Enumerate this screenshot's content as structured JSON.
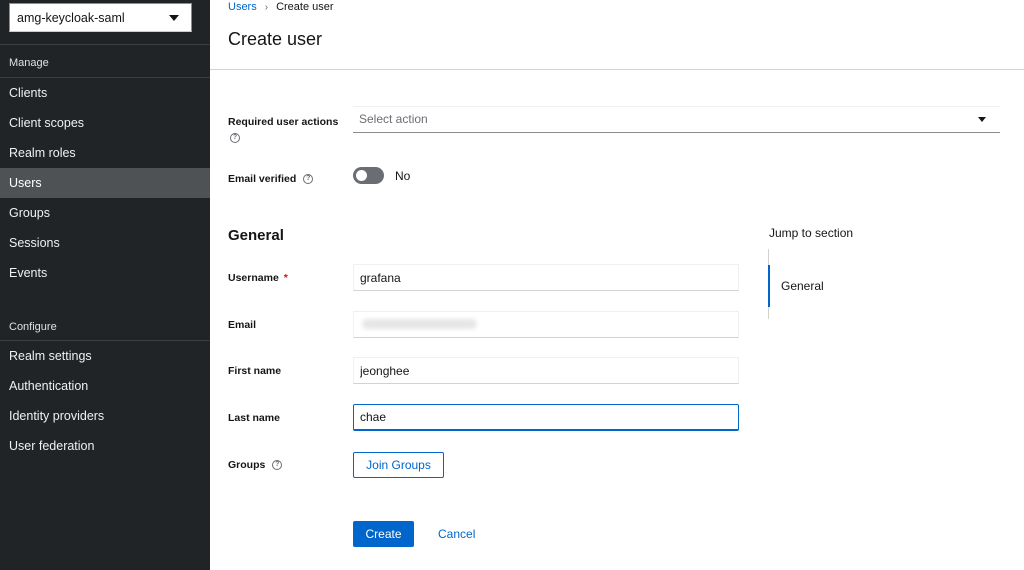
{
  "sidebar": {
    "realm": "amg-keycloak-saml",
    "manage_title": "Manage",
    "manage_items": [
      "Clients",
      "Client scopes",
      "Realm roles",
      "Users",
      "Groups",
      "Sessions",
      "Events"
    ],
    "active_item": "Users",
    "configure_title": "Configure",
    "configure_items": [
      "Realm settings",
      "Authentication",
      "Identity providers",
      "User federation"
    ]
  },
  "breadcrumb": {
    "parent": "Users",
    "current": "Create user"
  },
  "page": {
    "title": "Create user"
  },
  "form": {
    "required_actions_label": "Required user actions",
    "required_actions_placeholder": "Select action",
    "email_verified_label": "Email verified",
    "email_verified_value": "No",
    "general_heading": "General",
    "username_label": "Username",
    "username_value": "grafana",
    "email_label": "Email",
    "email_value": "",
    "first_name_label": "First name",
    "first_name_value": "jeonghee",
    "last_name_label": "Last name",
    "last_name_value": "chae",
    "groups_label": "Groups",
    "join_groups_button": "Join Groups",
    "create_button": "Create",
    "cancel_button": "Cancel"
  },
  "jump": {
    "title": "Jump to section",
    "items": [
      "General"
    ]
  },
  "icons": {
    "help": "help-circle-icon",
    "caret": "caret-down-icon",
    "required": "*"
  },
  "colors": {
    "sidebar_bg": "#212427",
    "active_nav_bg": "#4f5255",
    "accent": "#0066cc",
    "required": "#c9190b"
  }
}
